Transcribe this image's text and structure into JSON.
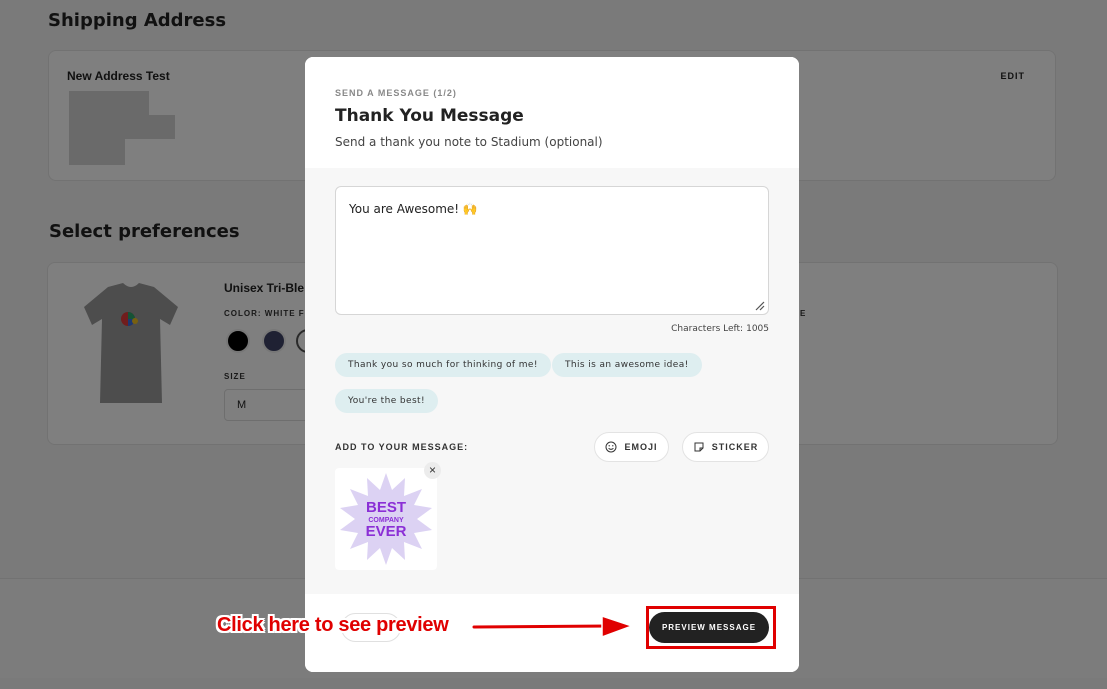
{
  "background": {
    "shipping_title": "Shipping Address",
    "address_name": "New Address Test",
    "edit_label": "EDIT",
    "preferences_title": "Select preferences",
    "product_title": "Unisex Tri-Ble",
    "color_label": "COLOR: WHITE F",
    "size_label": "SIZE",
    "size_value": "M",
    "right_label": "E"
  },
  "modal": {
    "step": "SEND A MESSAGE (1/2)",
    "title": "Thank You Message",
    "subtitle": "Send a thank you note to Stadium (optional)",
    "message_value": "You are Awesome! 🙌",
    "chars_label": "Characters Left:",
    "chars_count": "1005",
    "suggestions": [
      "Thank you so much for thinking of me!",
      "This is an awesome idea!",
      "You're the best!"
    ],
    "add_label": "ADD TO YOUR MESSAGE:",
    "emoji_label": "EMOJI",
    "sticker_label": "STICKER",
    "sticker_text": [
      "BEST",
      "COMPANY",
      "EVER"
    ],
    "close_glyph": "×",
    "preview_label": "PREVIEW MESSAGE"
  },
  "annotation": {
    "callout": "Click here to see preview",
    "color": "#e00000"
  },
  "colors": {
    "chip_bg": "#deeef0",
    "button_dark": "#222222",
    "sticker_purple": "#8b2fd6"
  }
}
